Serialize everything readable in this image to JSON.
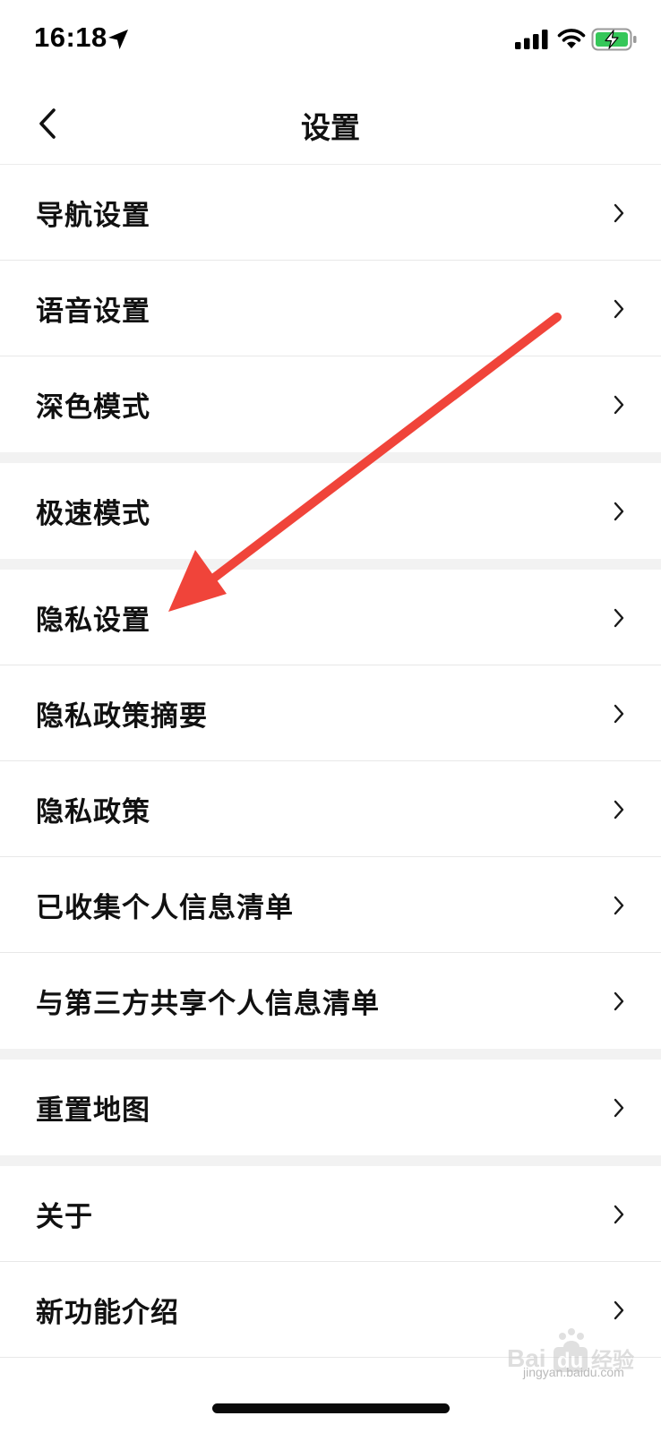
{
  "status_bar": {
    "time": "16:18",
    "icons": [
      "location-arrow-icon",
      "cellular-signal-icon",
      "wifi-icon",
      "battery-charging-icon"
    ]
  },
  "nav": {
    "title": "设置",
    "back_icon": "chevron-left-icon"
  },
  "settings": {
    "group1": [
      "导航设置",
      "语音设置",
      "深色模式"
    ],
    "group2": [
      "极速模式"
    ],
    "group3": [
      "隐私设置",
      "隐私政策摘要",
      "隐私政策",
      "已收集个人信息清单",
      "与第三方共享个人信息清单"
    ],
    "group4": [
      "重置地图"
    ],
    "group5": [
      "关于",
      "新功能介绍"
    ]
  },
  "annotation": {
    "type": "arrow",
    "color": "#f0443a",
    "points_to": "隐私设置"
  },
  "watermark": {
    "logo": "Bai du 经验",
    "url": "jingyan.baidu.com"
  },
  "colors": {
    "background": "#ffffff",
    "section_gap": "#f2f2f2",
    "divider": "#e8e8e8",
    "text": "#111111",
    "chevron": "#1a1a1a",
    "battery_fill": "#35c759",
    "arrow": "#f0443a"
  }
}
